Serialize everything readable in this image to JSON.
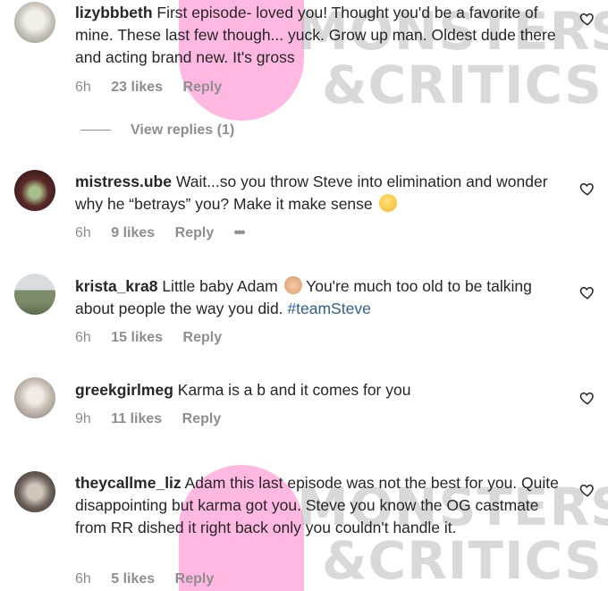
{
  "watermark": {
    "line1": "MONSTERS",
    "line2": "&CRITICS",
    "color": "#b9b9b9",
    "blob_color": "#ff7dc8"
  },
  "heart_icon": "heart-outline-icon",
  "comments": [
    {
      "username": "lizybbbeth",
      "text": "First episode- loved you! Thought you'd be a favorite of mine. These last few though... yuck. Grow up man. Oldest dude there and acting brand new. It's gross",
      "time": "6h",
      "likes": "23 likes",
      "reply": "Reply",
      "view_replies": "View replies (1)"
    },
    {
      "username": "mistress.ube",
      "text": "Wait...so you throw Steve into elimination and wonder why he “betrays” you? Make it make sense",
      "emoji": "thinking-face-emoji",
      "time": "6h",
      "likes": "9 likes",
      "reply": "Reply",
      "more": "•••"
    },
    {
      "username": "krista_kra8",
      "text_before": "Little baby Adam",
      "emoji": "baby-emoji",
      "text_after": "You're much too old to be talking about people the way you did.",
      "hashtag": "#teamSteve",
      "time": "6h",
      "likes": "15 likes",
      "reply": "Reply"
    },
    {
      "username": "greekgirlmeg",
      "text": "Karma is a b and it comes for you",
      "time": "9h",
      "likes": "11 likes",
      "reply": "Reply"
    },
    {
      "username": "theycallme_liz",
      "text": "Adam this last episode was not the best for you. Quite disappointing but karma got you. Steve you know the OG castmate from RR dished it right back only you couldn't handle it.",
      "time": "6h",
      "likes": "5 likes",
      "reply": "Reply"
    }
  ]
}
